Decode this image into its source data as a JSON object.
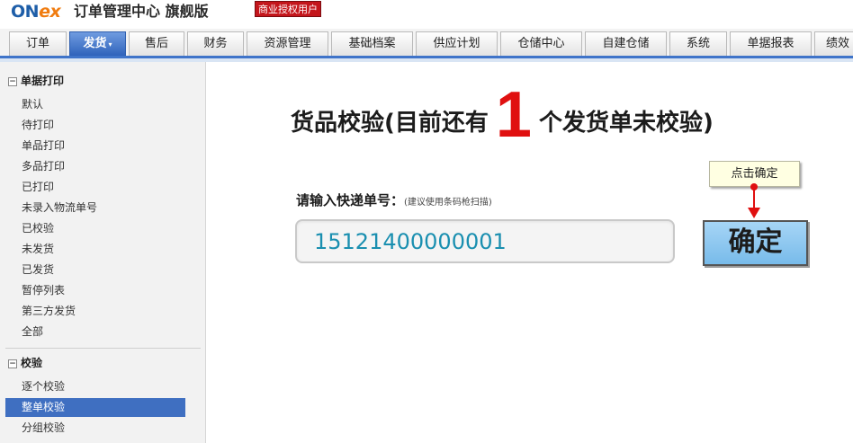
{
  "header": {
    "logo_on": "ON",
    "logo_ex": "ex",
    "app_title": "订单管理中心 旗舰版",
    "license_badge": "商业授权用户"
  },
  "nav": {
    "tabs": [
      {
        "label": "订单"
      },
      {
        "label": "发货",
        "active": true
      },
      {
        "label": "售后"
      },
      {
        "label": "财务"
      },
      {
        "label": "资源管理"
      },
      {
        "label": "基础档案"
      },
      {
        "label": "供应计划"
      },
      {
        "label": "仓储中心"
      },
      {
        "label": "自建仓储"
      },
      {
        "label": "系统"
      },
      {
        "label": "单据报表"
      },
      {
        "label": "绩效"
      }
    ]
  },
  "sidebar": {
    "section_print": {
      "title": "单据打印",
      "items": [
        "默认",
        "待打印",
        "单品打印",
        "多品打印",
        "已打印",
        "未录入物流单号",
        "已校验",
        "未发货",
        "已发货",
        "暂停列表",
        "第三方发货",
        "全部"
      ]
    },
    "section_verify": {
      "title": "校验",
      "items": [
        "逐个校验",
        "整单校验",
        "分组校验"
      ],
      "active_index": 1
    }
  },
  "main": {
    "heading_prefix": "货品校验(目前还有",
    "pending_count": "1",
    "heading_suffix": "个发货单未校验)",
    "tooltip": "点击确定",
    "input_label": "请输入快递单号：",
    "input_hint": "(建议使用条码枪扫描)",
    "tracking_number": "15121400000001",
    "confirm_label": "确定"
  },
  "colors": {
    "accent_blue": "#3f74c9",
    "count_red": "#e01010",
    "tracking_text": "#1a8fb0",
    "badge_red": "#c4161c"
  }
}
